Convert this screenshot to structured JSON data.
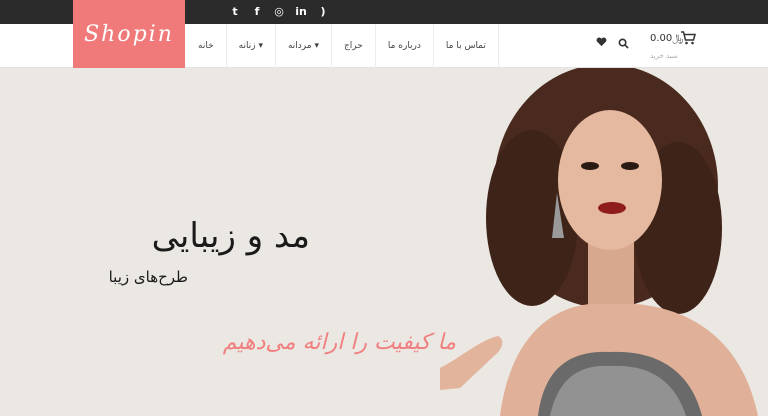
{
  "logo": {
    "text": "Shopin"
  },
  "social": [
    "twitter-icon",
    "facebook-icon",
    "dribbble-icon",
    "linkedin-icon",
    "rss-icon"
  ],
  "social_glyphs": [
    "t",
    "f",
    "◎",
    "in",
    ")"
  ],
  "menu": {
    "items": [
      "خانه",
      "زنانه ▾",
      "مردانه ▾",
      "حراج",
      "درباره ما",
      "تماس با ما"
    ]
  },
  "cart": {
    "price": "‎0.00‎‏﷼",
    "subtitle": "سبد خرید"
  },
  "hero": {
    "headline": "مد و زیبایی",
    "subline": "طرح‌های زیبا",
    "tagline": "ما کیفیت را ارائه می‌دهیم"
  },
  "colors": {
    "brand": "#f07a7a",
    "topbar": "#2b2b2b",
    "hero_bg": "#ebe7e2",
    "tagline": "#f08080"
  }
}
